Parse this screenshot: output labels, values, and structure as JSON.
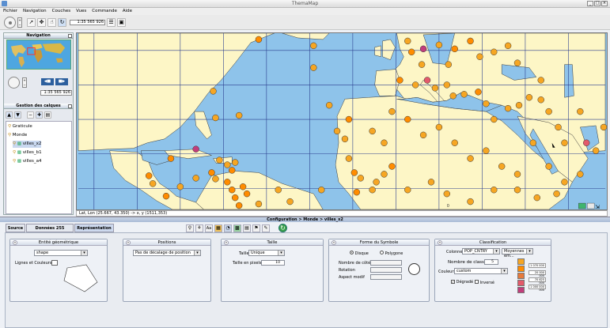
{
  "window": {
    "title": "ThemaMap"
  },
  "menu": [
    "Fichier",
    "Navigation",
    "Couches",
    "Vues",
    "Commande",
    "Aide"
  ],
  "toolbar": {
    "scale_value": "1:35 565 926"
  },
  "navigation": {
    "title": "Navigation",
    "scale_value": "1:35 565 926"
  },
  "layers_panel": {
    "title": "Gestion des calques",
    "items": [
      "Graticule",
      "Monde",
      "villes_x2",
      "villes_b1",
      "villes_a4"
    ]
  },
  "statusbar": {
    "coords": "Lat, Lon (25.667, 43.350) -> x, y (1511,353)"
  },
  "config": {
    "title": "Configuration > Monde > villes_x2",
    "tabs": [
      "Source",
      "Données 255 (lignes)",
      "Représentation"
    ],
    "active_tab": "Représentation"
  },
  "groups": {
    "entite": {
      "title": "Entité géométrique",
      "shape_value": "shape",
      "lines_label": "Lignes et Couleurs"
    },
    "position": {
      "title": "Positions",
      "value": "Pas de décalage de position"
    },
    "taille": {
      "title": "Taille",
      "taille_label": "Taille",
      "taille_value": "Unique",
      "pixels_label": "Taille en pixels",
      "pixels_value": "10"
    },
    "forme": {
      "title": "Forme du Symbole",
      "disque": "Disque",
      "polygone": "Polygone",
      "cotes_label": "Nombre de côtés",
      "rotation_label": "Rotation",
      "aspect_label": "Aspect modif"
    },
    "classif": {
      "title": "Classification",
      "colonne_label": "Colonne",
      "colonne_value": "POP_CNTRY",
      "method_value": "Moyennes em...",
      "nb_classes_label": "Nombre de classes",
      "nb_classes_value": "5",
      "couleurs_label": "Couleurs",
      "couleurs_value": "custom",
      "degrade_label": "Dégradé",
      "inverse_label": "Inversé",
      "class_values": [
        "1 070 000",
        "20 000 000",
        "70 625 000",
        "1 000 000 000"
      ]
    }
  },
  "colors": {
    "ocean": "#8ec3ea",
    "land": "#fdf6c6",
    "grid": "#2b3f8f",
    "class": [
      "#f6a623",
      "#ff8c00",
      "#e67a3c",
      "#e35a6b",
      "#c23d7c"
    ]
  }
}
